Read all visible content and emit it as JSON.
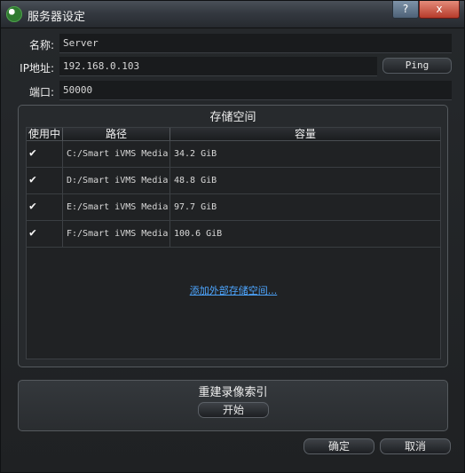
{
  "window": {
    "title": "服务器设定",
    "help": "?",
    "close": "x"
  },
  "fields": {
    "name_label": "名称:",
    "name_value": "Server",
    "ip_label": "IP地址:",
    "ip_value": "192.168.0.103",
    "port_label": "端口:",
    "port_value": "50000",
    "ping_button": "Ping"
  },
  "storage": {
    "title": "存储空间",
    "headers": {
      "use": "使用中",
      "path": "路径",
      "capacity": "容量"
    },
    "rows": [
      {
        "checked": "✔",
        "path": "C:/Smart iVMS Media",
        "capacity": "34.2 GiB"
      },
      {
        "checked": "✔",
        "path": "D:/Smart iVMS Media",
        "capacity": "48.8 GiB"
      },
      {
        "checked": "✔",
        "path": "E:/Smart iVMS Media",
        "capacity": "97.7 GiB"
      },
      {
        "checked": "✔",
        "path": "F:/Smart iVMS Media",
        "capacity": "100.6 GiB"
      }
    ],
    "add_link": "添加外部存储空间..."
  },
  "rebuild": {
    "title": "重建录像索引",
    "start_button": "开始"
  },
  "footer": {
    "ok": "确定",
    "cancel": "取消"
  }
}
